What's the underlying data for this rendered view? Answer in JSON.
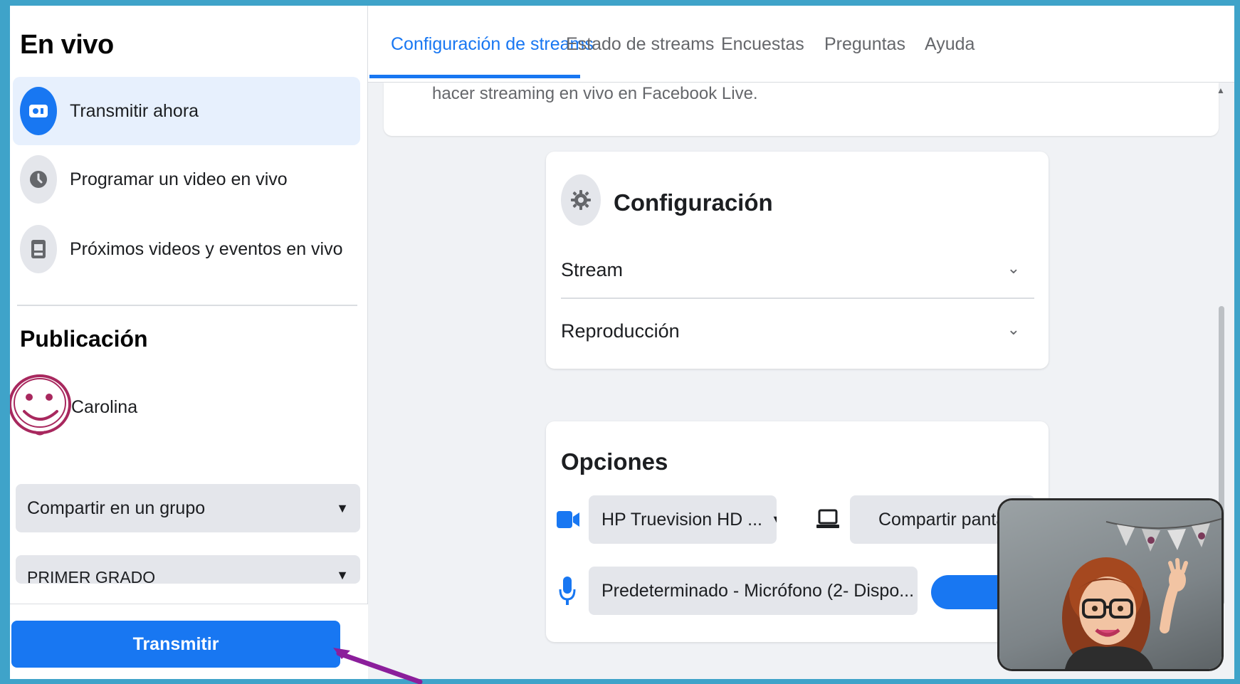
{
  "sidebar": {
    "title": "En vivo",
    "items": [
      {
        "label": "Transmitir ahora",
        "icon": "live-camera-icon"
      },
      {
        "label": "Programar un video en vivo",
        "icon": "clock-icon"
      },
      {
        "label": "Próximos videos y eventos en vivo",
        "icon": "calendar-icon"
      }
    ],
    "publication_title": "Publicación",
    "profile_name": "Carolina",
    "share_select": "Compartir en un grupo",
    "group_select": "PRIMER GRADO",
    "go_live_button": "Transmitir"
  },
  "tabs": [
    {
      "label": "Configuración de streams",
      "active": true
    },
    {
      "label": "Estado de streams",
      "active": false
    },
    {
      "label": "Encuestas",
      "active": false
    },
    {
      "label": "Preguntas",
      "active": false
    },
    {
      "label": "Ayuda",
      "active": false
    }
  ],
  "intro_text": "hacer streaming en vivo en Facebook Live.",
  "settings": {
    "title": "Configuración",
    "sections": [
      "Stream",
      "Reproducción"
    ]
  },
  "options": {
    "title": "Opciones",
    "camera": "HP Truevision HD ...",
    "share_screen": "Compartir pantalla",
    "microphone": "Predeterminado - Micrófono (2- Dispo..."
  },
  "colors": {
    "accent": "#1877f2",
    "frame_border": "#3fa3c9",
    "annotation_arrow": "#8b1e9b",
    "avatar_doodle": "#a8285e"
  }
}
